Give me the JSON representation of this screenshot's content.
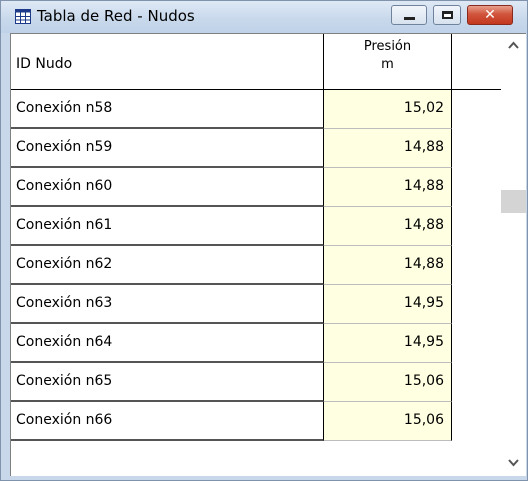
{
  "window": {
    "title": "Tabla de Red - Nudos"
  },
  "table": {
    "columns": [
      {
        "label": "ID Nudo"
      },
      {
        "label_line1": "Presión",
        "label_line2": "m"
      }
    ],
    "rows": [
      {
        "id": "Conexión n58",
        "presion": "15,02"
      },
      {
        "id": "Conexión n59",
        "presion": "14,88"
      },
      {
        "id": "Conexión n60",
        "presion": "14,88"
      },
      {
        "id": "Conexión n61",
        "presion": "14,88"
      },
      {
        "id": "Conexión n62",
        "presion": "14,88"
      },
      {
        "id": "Conexión n63",
        "presion": "14,95"
      },
      {
        "id": "Conexión n64",
        "presion": "14,95"
      },
      {
        "id": "Conexión n65",
        "presion": "15,06"
      },
      {
        "id": "Conexión n66",
        "presion": "15,06"
      }
    ]
  },
  "icons": {
    "window": "table-grid-icon",
    "minimize": "minimize-icon",
    "maximize": "maximize-icon",
    "close": "close-icon",
    "scroll_up": "chevron-up-icon",
    "scroll_down": "chevron-down-icon"
  },
  "colors": {
    "value_cell_bg": "#ffffe1",
    "titlebar": "#c9d9ec",
    "close_button": "#c3381f"
  }
}
